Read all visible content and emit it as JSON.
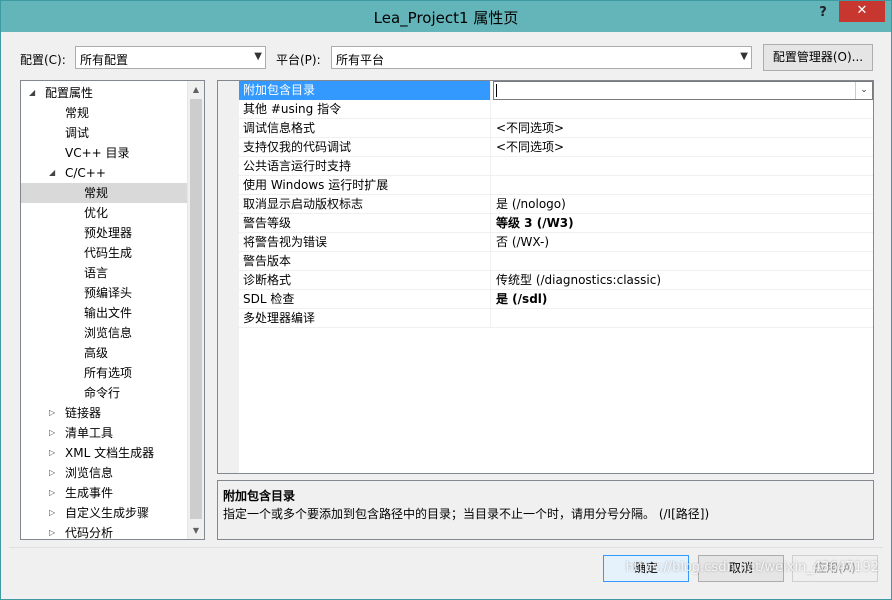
{
  "window": {
    "title": "Lea_Project1 属性页",
    "help_glyph": "?",
    "close_glyph": "✕"
  },
  "toolbar": {
    "config_label": "配置(C):",
    "config_value": "所有配置",
    "platform_label": "平台(P):",
    "platform_value": "所有平台",
    "config_manager_label": "配置管理器(O)..."
  },
  "tree": {
    "items": [
      {
        "label": "配置属性",
        "level": 0,
        "expander": "expanded"
      },
      {
        "label": "常规",
        "level": 1,
        "expander": "none"
      },
      {
        "label": "调试",
        "level": 1,
        "expander": "none"
      },
      {
        "label": "VC++ 目录",
        "level": 1,
        "expander": "none"
      },
      {
        "label": "C/C++",
        "level": 1,
        "expander": "expanded"
      },
      {
        "label": "常规",
        "level": 2,
        "expander": "none",
        "selected": true
      },
      {
        "label": "优化",
        "level": 2,
        "expander": "none"
      },
      {
        "label": "预处理器",
        "level": 2,
        "expander": "none"
      },
      {
        "label": "代码生成",
        "level": 2,
        "expander": "none"
      },
      {
        "label": "语言",
        "level": 2,
        "expander": "none"
      },
      {
        "label": "预编译头",
        "level": 2,
        "expander": "none"
      },
      {
        "label": "输出文件",
        "level": 2,
        "expander": "none"
      },
      {
        "label": "浏览信息",
        "level": 2,
        "expander": "none"
      },
      {
        "label": "高级",
        "level": 2,
        "expander": "none"
      },
      {
        "label": "所有选项",
        "level": 2,
        "expander": "none"
      },
      {
        "label": "命令行",
        "level": 2,
        "expander": "none"
      },
      {
        "label": "链接器",
        "level": 1,
        "expander": "collapsed"
      },
      {
        "label": "清单工具",
        "level": 1,
        "expander": "collapsed"
      },
      {
        "label": "XML 文档生成器",
        "level": 1,
        "expander": "collapsed"
      },
      {
        "label": "浏览信息",
        "level": 1,
        "expander": "collapsed"
      },
      {
        "label": "生成事件",
        "level": 1,
        "expander": "collapsed"
      },
      {
        "label": "自定义生成步骤",
        "level": 1,
        "expander": "collapsed"
      },
      {
        "label": "代码分析",
        "level": 1,
        "expander": "collapsed"
      }
    ]
  },
  "properties": {
    "rows": [
      {
        "name": "附加包含目录",
        "value": "",
        "selected": true,
        "editing": true
      },
      {
        "name": "其他 #using 指令",
        "value": ""
      },
      {
        "name": "调试信息格式",
        "value": "<不同选项>"
      },
      {
        "name": "支持仅我的代码调试",
        "value": "<不同选项>"
      },
      {
        "name": "公共语言运行时支持",
        "value": ""
      },
      {
        "name": "使用 Windows 运行时扩展",
        "value": ""
      },
      {
        "name": "取消显示启动版权标志",
        "value": "是 (/nologo)"
      },
      {
        "name": "警告等级",
        "value": "等级 3 (/W3)",
        "bold": true
      },
      {
        "name": "将警告视为错误",
        "value": "否 (/WX-)"
      },
      {
        "name": "警告版本",
        "value": ""
      },
      {
        "name": "诊断格式",
        "value": "传统型 (/diagnostics:classic)"
      },
      {
        "name": "SDL 检查",
        "value": "是 (/sdl)",
        "bold": true
      },
      {
        "name": "多处理器编译",
        "value": ""
      }
    ]
  },
  "description": {
    "title": "附加包含目录",
    "text": "指定一个或多个要添加到包含路径中的目录；当目录不止一个时，请用分号分隔。    (/I[路径])"
  },
  "buttons": {
    "ok": "确定",
    "cancel": "取消",
    "apply": "应用(A)"
  },
  "watermark": "https://blog.csdn.net/weixin_43647192",
  "colors": {
    "title_bar": "#63b5ba",
    "close_button": "#c7372f",
    "selection": "#3399ff"
  }
}
